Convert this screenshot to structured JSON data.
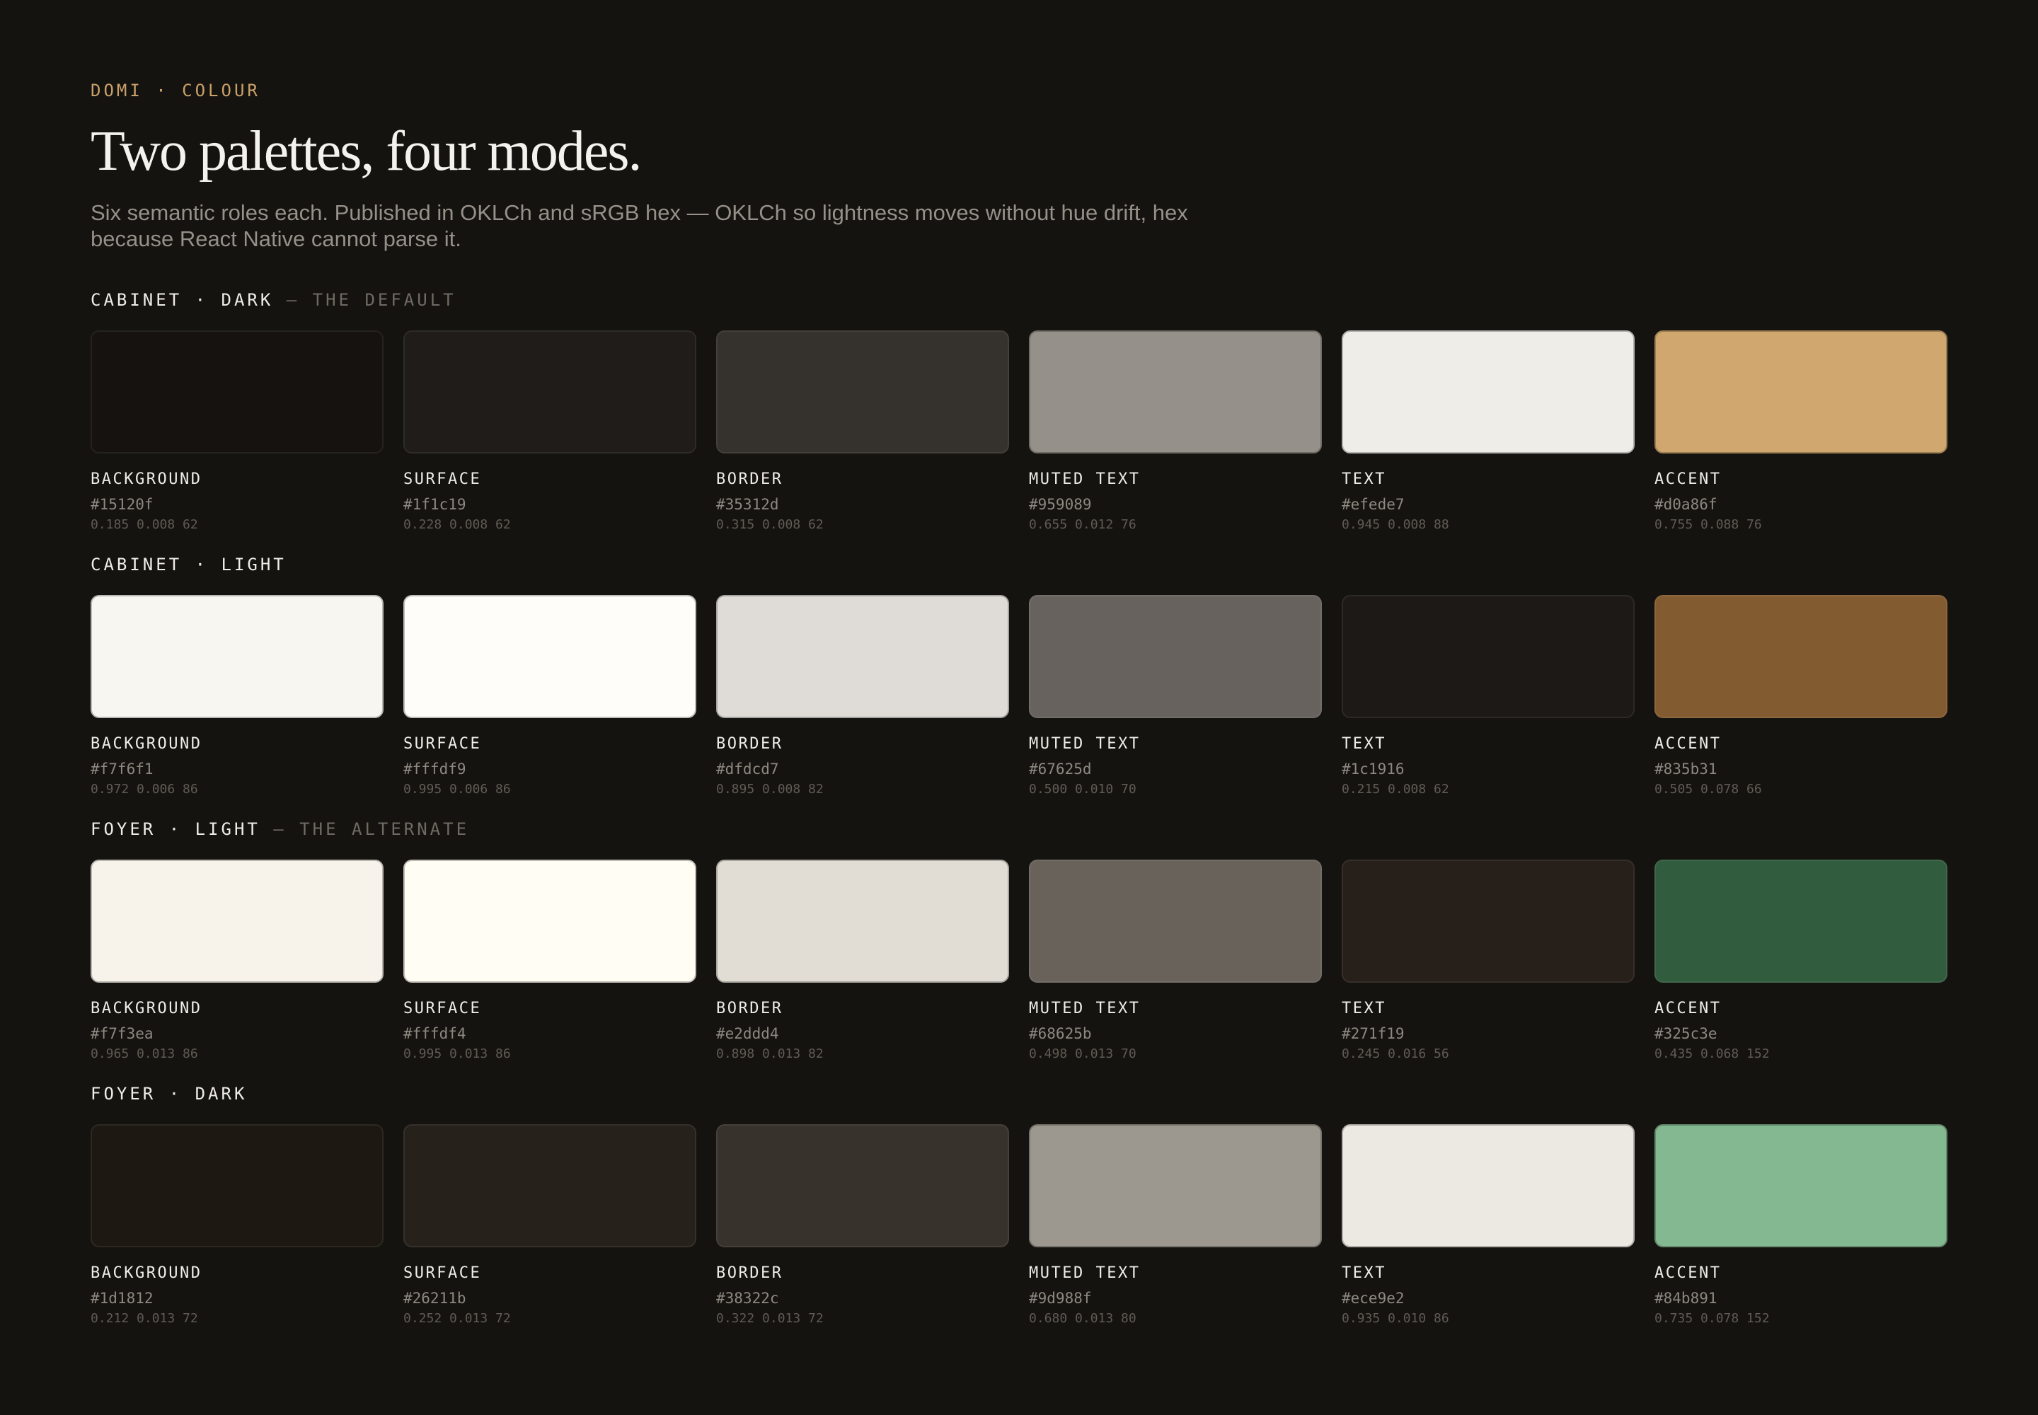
{
  "header": {
    "eyebrow": "DOMI · COLOUR",
    "title": "Two palettes, four modes.",
    "subtitle": "Six semantic roles each. Published in OKLCh and sRGB hex — OKLCh so lightness moves without hue drift, hex because React Native cannot parse it."
  },
  "palettes": [
    {
      "name": "CABINET · DARK",
      "note": " — THE DEFAULT",
      "swatches": [
        {
          "role": "BACKGROUND",
          "hex": "#15120f",
          "oklch": "0.185 0.008 62"
        },
        {
          "role": "SURFACE",
          "hex": "#1f1c19",
          "oklch": "0.228 0.008 62"
        },
        {
          "role": "BORDER",
          "hex": "#35312d",
          "oklch": "0.315 0.008 62"
        },
        {
          "role": "MUTED TEXT",
          "hex": "#959089",
          "oklch": "0.655 0.012 76"
        },
        {
          "role": "TEXT",
          "hex": "#efede7",
          "oklch": "0.945 0.008 88"
        },
        {
          "role": "ACCENT",
          "hex": "#d0a86f",
          "oklch": "0.755 0.088 76"
        }
      ]
    },
    {
      "name": "CABINET · LIGHT",
      "note": "",
      "swatches": [
        {
          "role": "BACKGROUND",
          "hex": "#f7f6f1",
          "oklch": "0.972 0.006 86"
        },
        {
          "role": "SURFACE",
          "hex": "#fffdf9",
          "oklch": "0.995 0.006 86"
        },
        {
          "role": "BORDER",
          "hex": "#dfdcd7",
          "oklch": "0.895 0.008 82"
        },
        {
          "role": "MUTED TEXT",
          "hex": "#67625d",
          "oklch": "0.500 0.010 70"
        },
        {
          "role": "TEXT",
          "hex": "#1c1916",
          "oklch": "0.215 0.008 62"
        },
        {
          "role": "ACCENT",
          "hex": "#835b31",
          "oklch": "0.505 0.078 66"
        }
      ]
    },
    {
      "name": "FOYER · LIGHT",
      "note": " — THE ALTERNATE",
      "swatches": [
        {
          "role": "BACKGROUND",
          "hex": "#f7f3ea",
          "oklch": "0.965 0.013 86"
        },
        {
          "role": "SURFACE",
          "hex": "#fffdf4",
          "oklch": "0.995 0.013 86"
        },
        {
          "role": "BORDER",
          "hex": "#e2ddd4",
          "oklch": "0.898 0.013 82"
        },
        {
          "role": "MUTED TEXT",
          "hex": "#68625b",
          "oklch": "0.498 0.013 70"
        },
        {
          "role": "TEXT",
          "hex": "#271f19",
          "oklch": "0.245 0.016 56"
        },
        {
          "role": "ACCENT",
          "hex": "#325c3e",
          "oklch": "0.435 0.068 152"
        }
      ]
    },
    {
      "name": "FOYER · DARK",
      "note": "",
      "swatches": [
        {
          "role": "BACKGROUND",
          "hex": "#1d1812",
          "oklch": "0.212 0.013 72"
        },
        {
          "role": "SURFACE",
          "hex": "#26211b",
          "oklch": "0.252 0.013 72"
        },
        {
          "role": "BORDER",
          "hex": "#38322c",
          "oklch": "0.322 0.013 72"
        },
        {
          "role": "MUTED TEXT",
          "hex": "#9d988f",
          "oklch": "0.680 0.013 80"
        },
        {
          "role": "TEXT",
          "hex": "#ece9e2",
          "oklch": "0.935 0.010 86"
        },
        {
          "role": "ACCENT",
          "hex": "#84b891",
          "oklch": "0.735 0.078 152"
        }
      ]
    }
  ]
}
